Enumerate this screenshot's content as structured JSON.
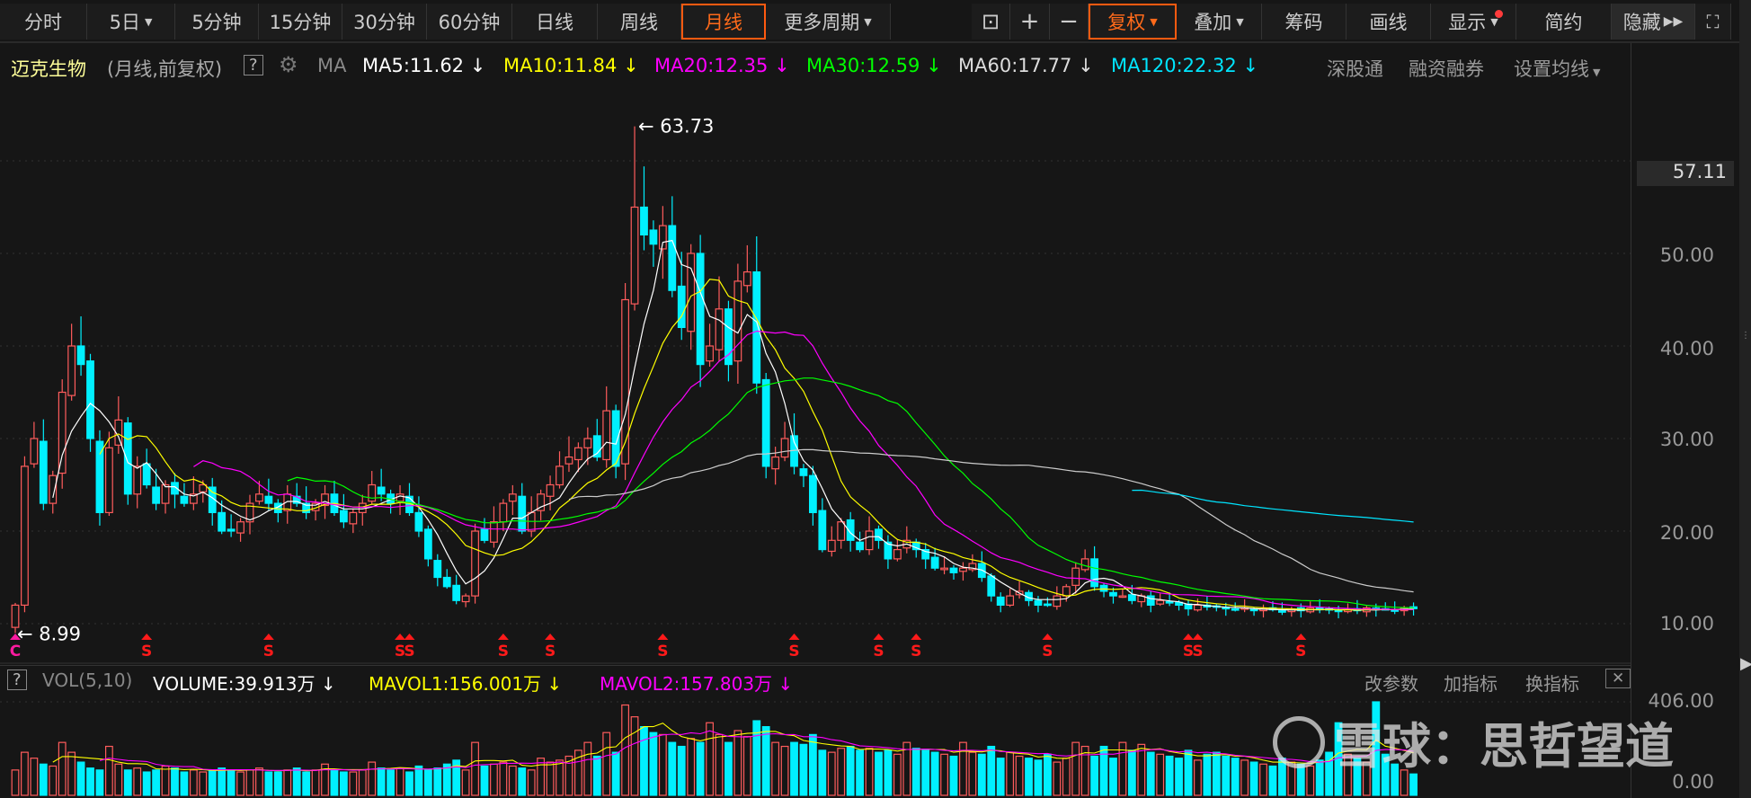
{
  "toolbar": {
    "periods": [
      "分时",
      "5日",
      "5分钟",
      "15分钟",
      "30分钟",
      "60分钟",
      "日线",
      "周线",
      "月线",
      "更多周期"
    ],
    "active_period": "月线",
    "tools": [
      "复权",
      "叠加",
      "筹码",
      "画线",
      "显示",
      "简约",
      "隐藏"
    ],
    "active_tool": "复权"
  },
  "header": {
    "stock_name": "迈克生物",
    "mode": "(月线,前复权)",
    "help": "?",
    "ma_label": "MA",
    "ma": [
      {
        "text": "MA5:11.62",
        "color": "#ffffff"
      },
      {
        "text": "MA10:11.84",
        "color": "#ffff00"
      },
      {
        "text": "MA20:12.35",
        "color": "#ff00ff"
      },
      {
        "text": "MA30:12.59",
        "color": "#00ff00"
      },
      {
        "text": "MA60:17.77",
        "color": "#dddddd"
      },
      {
        "text": "MA120:22.32",
        "color": "#00e5ff"
      }
    ],
    "arrow": "↓",
    "right_links": [
      "深股通",
      "融资融券",
      "设置均线"
    ]
  },
  "axis": {
    "price_ticks": [
      "50.00",
      "40.00",
      "30.00",
      "20.00",
      "10.00"
    ],
    "current_price": "57.11",
    "vol_ticks": [
      "406.00",
      "0.00"
    ]
  },
  "volume_header": {
    "help": "?",
    "name": "VOL(5,10)",
    "volume": "VOLUME:39.913万",
    "mavol1": "MAVOL1:156.001万",
    "mavol2": "MAVOL2:157.803万",
    "links": [
      "改参数",
      "加指标",
      "换指标"
    ],
    "close": "✕"
  },
  "watermark": "雪球：思哲望道",
  "colors": {
    "up": "#ff5c5c",
    "down": "#00f0ff",
    "ma5": "#ffffff",
    "ma10": "#ffff00",
    "ma20": "#ff00ff",
    "ma30": "#00ff00",
    "ma60": "#cccccc",
    "ma120": "#00e5ff"
  },
  "chart_data": {
    "type": "candlestick",
    "period": "monthly",
    "ylim": [
      10,
      60
    ],
    "high_label": "63.73",
    "high_value": 63.73,
    "low_label": "8.99",
    "low_value": 8.99,
    "closes": [
      12,
      27,
      30,
      23,
      26,
      35,
      40,
      38,
      30,
      22,
      29,
      32,
      24,
      27,
      25,
      23,
      25,
      24,
      23,
      24,
      25,
      22,
      20,
      20,
      21,
      23,
      24,
      23,
      22,
      24,
      23,
      22,
      23,
      24,
      22,
      21,
      22,
      23,
      25,
      24,
      23,
      24,
      22,
      20,
      17,
      15,
      14,
      12.5,
      13,
      20,
      19,
      21,
      23,
      24,
      20,
      22,
      24,
      25,
      27,
      28,
      29,
      30,
      28,
      33,
      27,
      45,
      55,
      52,
      51,
      53,
      46,
      42,
      50,
      38,
      40,
      44,
      38,
      47,
      48,
      36,
      27,
      28,
      30,
      27,
      26,
      22,
      18,
      19,
      21,
      19,
      18,
      20,
      19,
      17,
      18,
      19,
      18,
      17,
      16,
      16,
      15.5,
      16,
      16.5,
      15,
      13,
      12,
      13,
      13.5,
      12.5,
      12,
      12,
      13,
      14,
      16,
      17,
      14,
      13.5,
      13,
      13,
      12.5,
      13,
      12,
      12.5,
      12.3,
      12,
      11.6,
      12,
      11.8,
      11.9,
      11.6,
      11.5,
      11.7,
      11.4,
      11.6,
      11.5,
      11.3,
      11.6,
      11.4,
      11.7,
      11.5,
      11.6,
      11.3,
      11.5,
      11.4,
      11.7,
      11.5,
      11.6,
      11.4,
      11.7,
      11.62
    ],
    "volumes": [
      60,
      150,
      120,
      90,
      80,
      200,
      150,
      100,
      70,
      60,
      180,
      90,
      60,
      70,
      50,
      60,
      80,
      70,
      50,
      60,
      50,
      60,
      70,
      60,
      50,
      60,
      70,
      50,
      50,
      60,
      70,
      50,
      60,
      90,
      60,
      50,
      50,
      60,
      100,
      70,
      60,
      70,
      50,
      80,
      60,
      70,
      90,
      110,
      60,
      200,
      80,
      90,
      100,
      80,
      70,
      60,
      120,
      100,
      110,
      130,
      160,
      200,
      130,
      250,
      150,
      390,
      330,
      280,
      250,
      240,
      200,
      180,
      220,
      200,
      300,
      240,
      200,
      260,
      230,
      310,
      280,
      200,
      180,
      200,
      190,
      240,
      160,
      150,
      170,
      180,
      160,
      170,
      150,
      160,
      140,
      200,
      170,
      160,
      150,
      140,
      130,
      200,
      150,
      140,
      180,
      120,
      150,
      130,
      120,
      110,
      140,
      100,
      120,
      200,
      180,
      130,
      180,
      120,
      200,
      160,
      190,
      150,
      140,
      130,
      120,
      160,
      110,
      140,
      150,
      130,
      120,
      110,
      100,
      90,
      80,
      120,
      100,
      90,
      80,
      110,
      150,
      300,
      140,
      120,
      100,
      406,
      140,
      90,
      60,
      39.913
    ],
    "vol_ylim": [
      0,
      406
    ],
    "signal_markers": [
      {
        "index": 0,
        "label": "C"
      },
      {
        "index": 14,
        "label": "S"
      },
      {
        "index": 27,
        "label": "S"
      },
      {
        "index": 41,
        "label": "S"
      },
      {
        "index": 42,
        "label": "S"
      },
      {
        "index": 52,
        "label": "S"
      },
      {
        "index": 57,
        "label": "S"
      },
      {
        "index": 69,
        "label": "S"
      },
      {
        "index": 83,
        "label": "S"
      },
      {
        "index": 92,
        "label": "S"
      },
      {
        "index": 96,
        "label": "S"
      },
      {
        "index": 110,
        "label": "S"
      },
      {
        "index": 125,
        "label": "S"
      },
      {
        "index": 126,
        "label": "S"
      },
      {
        "index": 137,
        "label": "S"
      }
    ],
    "ma_periods": [
      5,
      10,
      20,
      30,
      60,
      120
    ]
  }
}
